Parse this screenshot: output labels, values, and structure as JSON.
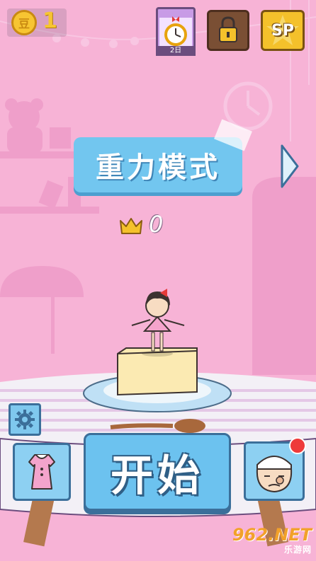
{
  "header": {
    "coin_symbol": "豆",
    "coin_count": "1",
    "clock_day_label": "2日",
    "sp_label": "SP"
  },
  "mode": {
    "title": "重力模式",
    "best_score": "0"
  },
  "actions": {
    "start_label": "开始"
  },
  "watermark": {
    "main": "962.NET",
    "sub": "乐游网"
  },
  "colors": {
    "background": "#f7b3d6",
    "button_blue": "#72c6ef",
    "coin_gold": "#f7c532",
    "notification_red": "#ee3a3a"
  },
  "icons": [
    "coin-icon",
    "alarm-clock-icon",
    "lock-icon",
    "sp-star-icon",
    "next-arrow-icon",
    "crown-icon",
    "gear-icon",
    "dress-icon",
    "chef-face-icon"
  ]
}
